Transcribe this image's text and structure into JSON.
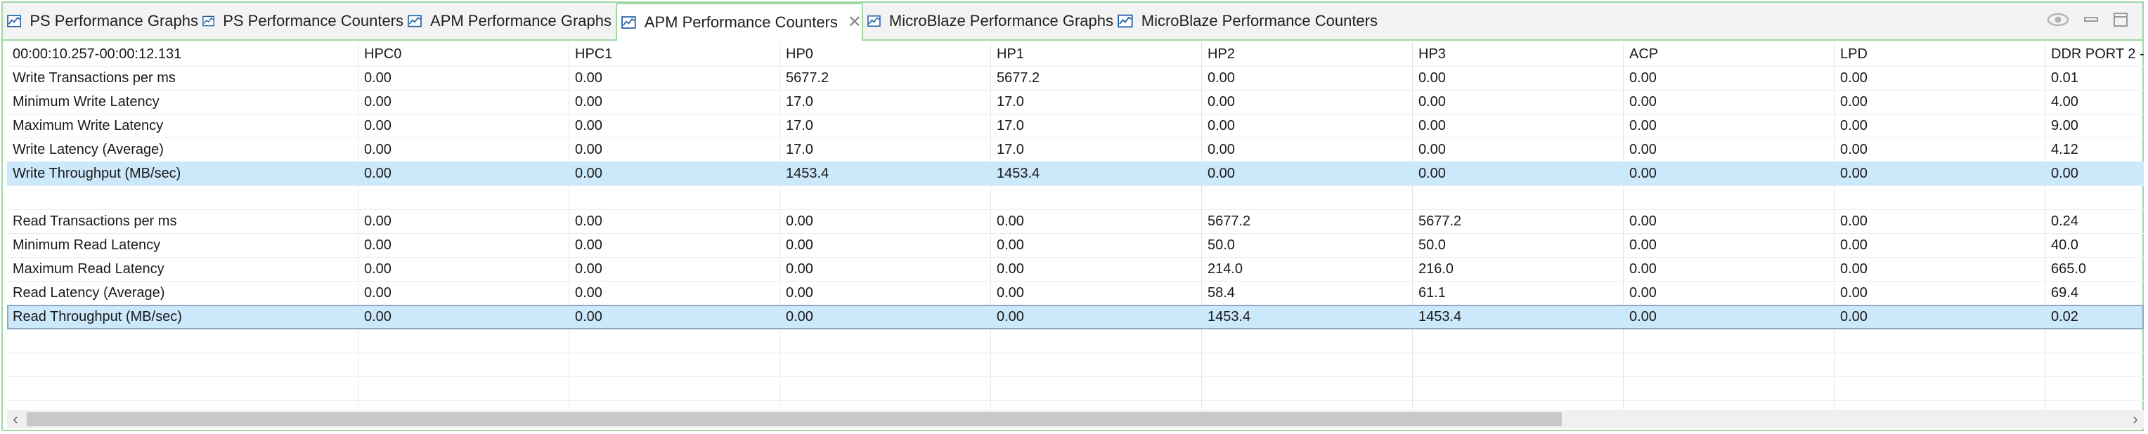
{
  "tabs": [
    {
      "label": "PS Performance Graphs",
      "active": false,
      "closable": false
    },
    {
      "label": "PS Performance Counters",
      "active": false,
      "closable": false
    },
    {
      "label": "APM Performance Graphs",
      "active": false,
      "closable": false
    },
    {
      "label": "APM Performance Counters",
      "active": true,
      "closable": true
    },
    {
      "label": "MicroBlaze Performance Graphs",
      "active": false,
      "closable": false
    },
    {
      "label": "MicroBlaze Performance Counters",
      "active": false,
      "closable": false
    }
  ],
  "tab_icon": "chart-line-icon",
  "window_controls": [
    "eye-icon",
    "minimize-icon",
    "maximize-icon"
  ],
  "colors": {
    "accent_border": "#9fd6a6",
    "selected_row": "#cce8fb",
    "icon_blue": "#1f5fa8"
  },
  "table": {
    "columns": [
      "00:00:10.257-00:00:12.131",
      "HPC0",
      "HPC1",
      "HP0",
      "HP1",
      "HP2",
      "HP3",
      "ACP",
      "LPD",
      "DDR PORT 2 -"
    ],
    "rows": [
      {
        "cells": [
          "Write Transactions per ms",
          "0.00",
          "0.00",
          "5677.2",
          "5677.2",
          "0.00",
          "0.00",
          "0.00",
          "0.00",
          "0.01"
        ]
      },
      {
        "cells": [
          "Minimum Write Latency",
          "0.00",
          "0.00",
          "17.0",
          "17.0",
          "0.00",
          "0.00",
          "0.00",
          "0.00",
          "4.00"
        ]
      },
      {
        "cells": [
          "Maximum Write Latency",
          "0.00",
          "0.00",
          "17.0",
          "17.0",
          "0.00",
          "0.00",
          "0.00",
          "0.00",
          "9.00"
        ]
      },
      {
        "cells": [
          "Write Latency (Average)",
          "0.00",
          "0.00",
          "17.0",
          "17.0",
          "0.00",
          "0.00",
          "0.00",
          "0.00",
          "4.12"
        ]
      },
      {
        "cells": [
          "Write Throughput (MB/sec)",
          "0.00",
          "0.00",
          "1453.4",
          "1453.4",
          "0.00",
          "0.00",
          "0.00",
          "0.00",
          "0.00"
        ],
        "selected": true
      },
      {
        "cells": [
          "",
          "",
          "",
          "",
          "",
          "",
          "",
          "",
          "",
          ""
        ]
      },
      {
        "cells": [
          "Read Transactions per ms",
          "0.00",
          "0.00",
          "0.00",
          "0.00",
          "5677.2",
          "5677.2",
          "0.00",
          "0.00",
          "0.24"
        ]
      },
      {
        "cells": [
          "Minimum Read Latency",
          "0.00",
          "0.00",
          "0.00",
          "0.00",
          "50.0",
          "50.0",
          "0.00",
          "0.00",
          "40.0"
        ]
      },
      {
        "cells": [
          "Maximum Read Latency",
          "0.00",
          "0.00",
          "0.00",
          "0.00",
          "214.0",
          "216.0",
          "0.00",
          "0.00",
          "665.0"
        ]
      },
      {
        "cells": [
          "Read Latency (Average)",
          "0.00",
          "0.00",
          "0.00",
          "0.00",
          "58.4",
          "61.1",
          "0.00",
          "0.00",
          "69.4"
        ]
      },
      {
        "cells": [
          "Read Throughput (MB/sec)",
          "0.00",
          "0.00",
          "0.00",
          "0.00",
          "1453.4",
          "1453.4",
          "0.00",
          "0.00",
          "0.02"
        ],
        "selected": true,
        "focused": true
      }
    ],
    "empty_rows": 4
  },
  "scrollbar": {
    "left_arrow": "‹",
    "right_arrow": "›",
    "thumb_fraction": 0.73
  }
}
